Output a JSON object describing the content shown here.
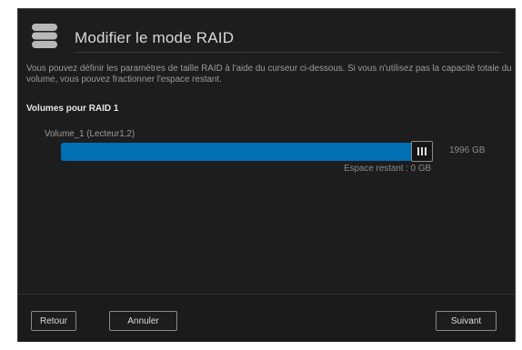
{
  "dialog": {
    "title": "Modifier le mode RAID",
    "icon": "database-icon",
    "description": "Vous pouvez définir les paramètres de taille RAID à l'aide du curseur ci-dessous. Si vous n'utilisez pas la capacité totale du volume, vous pouvez fractionner l'espace restant.",
    "section_label": "Volumes pour RAID 1",
    "volume": {
      "label": "Volume_1 (Lecteur1,2)",
      "size": "1996 GB",
      "remaining": "Espace restant : 0 GB",
      "fill_fraction": 1.0
    },
    "buttons": {
      "back": "Retour",
      "cancel": "Annuler",
      "next": "Suivant"
    }
  },
  "colors": {
    "accent": "#006fb3",
    "background": "#1d1d1d",
    "text": "#d9d9d9",
    "muted_text": "#9c9c9c"
  }
}
